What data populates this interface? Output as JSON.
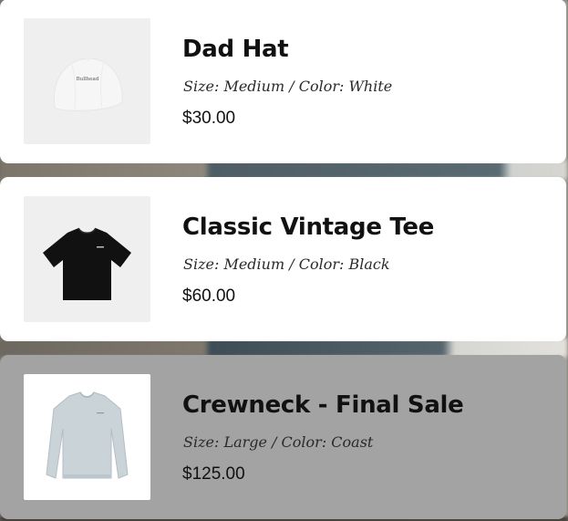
{
  "items": [
    {
      "name": "Dad Hat",
      "variant": "Size: Medium / Color: White",
      "price": "$30.00",
      "thumb_logo_text": "Bullhead"
    },
    {
      "name": "Classic Vintage Tee",
      "variant": "Size: Medium / Color: Black",
      "price": "$60.00"
    },
    {
      "name": "Crewneck - Final Sale",
      "variant": "Size: Large / Color: Coast",
      "price": "$125.00"
    }
  ],
  "colors": {
    "card_bg": "#ffffff",
    "dimmed_card_bg": "#a3a3a3",
    "thumb_bg": "#efefef",
    "text": "#111111",
    "tee": "#111111",
    "crewneck": "#c9d3d8"
  },
  "icons": [
    "dad-hat-image",
    "tee-image",
    "crewneck-image"
  ]
}
